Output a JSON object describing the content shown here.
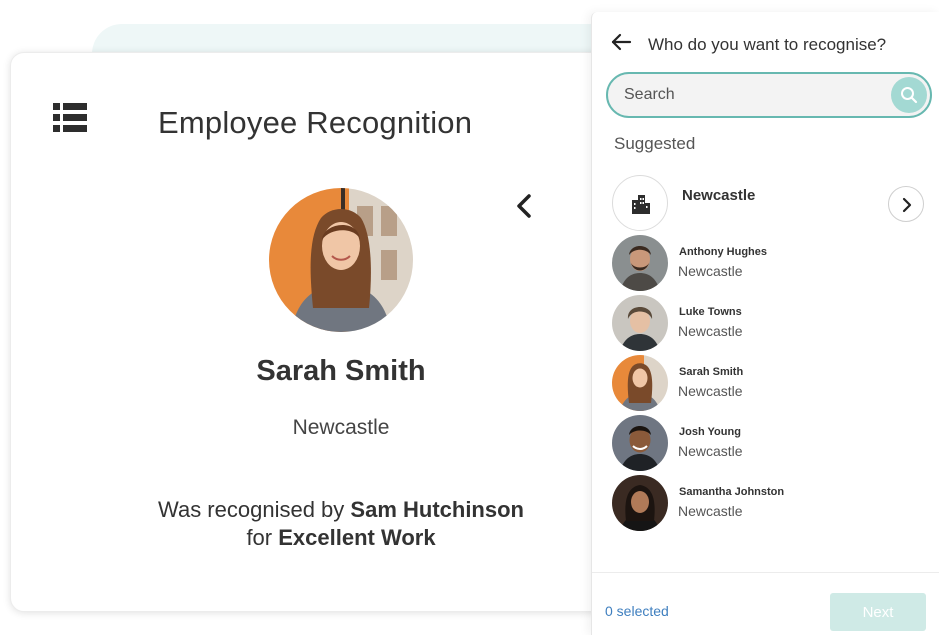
{
  "card": {
    "title": "Employee Recognition",
    "person_name": "Sarah Smith",
    "person_location": "Newcastle",
    "recognition_prefix": "Was recognised by ",
    "recognised_by": "Sam Hutchinson",
    "for_prefix": "for ",
    "reason": "Excellent Work"
  },
  "panel": {
    "title": "Who do you want to recognise?",
    "search_placeholder": "Search",
    "suggested_label": "Suggested",
    "group": {
      "name": "Newcastle",
      "icon": "building-icon"
    },
    "people": [
      {
        "name": "Anthony Hughes",
        "location": "Newcastle"
      },
      {
        "name": "Luke Towns",
        "location": "Newcastle"
      },
      {
        "name": "Sarah Smith",
        "location": "Newcastle"
      },
      {
        "name": "Josh Young",
        "location": "Newcastle"
      },
      {
        "name": "Samantha Johnston",
        "location": "Newcastle"
      }
    ],
    "selected_count": "0 selected",
    "next_label": "Next"
  },
  "colors": {
    "accent": "#67b8b0",
    "link": "#3f7fbf",
    "next_disabled": "#cfeae6"
  }
}
